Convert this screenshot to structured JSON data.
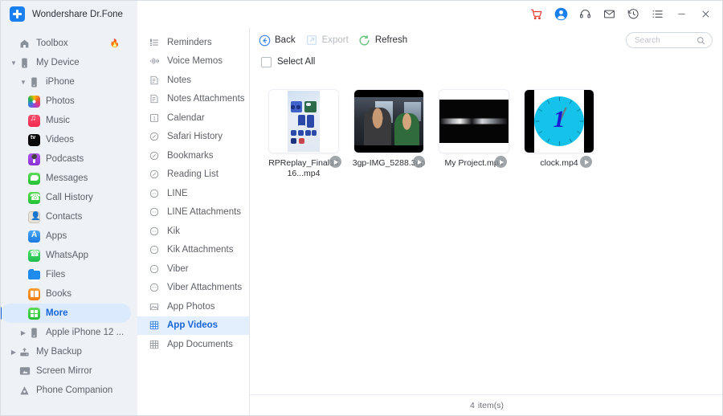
{
  "window": {
    "app_title": "Wondershare Dr.Fone",
    "logo_icon": "drfone-plus-logo",
    "titlebar_icons": [
      {
        "name": "shopping-cart-icon",
        "color": "#e8342a"
      },
      {
        "name": "user-account-icon",
        "color": "#1a7ff0"
      },
      {
        "name": "support-headset-icon",
        "color": "#4a4f57"
      },
      {
        "name": "mail-icon",
        "color": "#4a4f57"
      },
      {
        "name": "history-clock-icon",
        "color": "#4a4f57"
      },
      {
        "name": "menu-list-icon",
        "color": "#4a4f57"
      },
      {
        "name": "minimize-icon",
        "color": "#4a4f57"
      },
      {
        "name": "close-icon",
        "color": "#4a4f57"
      }
    ]
  },
  "sidebar": {
    "items": [
      {
        "label": "Toolbox",
        "icon": "home-icon",
        "level": 1,
        "chevron": "",
        "selected": false,
        "badge": "fire-icon"
      },
      {
        "label": "My Device",
        "icon": "device-icon",
        "level": 1,
        "chevron": "v",
        "selected": false
      },
      {
        "label": "iPhone",
        "icon": "iphone-icon",
        "level": 2,
        "chevron": "v",
        "selected": false
      },
      {
        "label": "Photos",
        "icon": "photos-app-icon",
        "level": 3,
        "chevron": "",
        "selected": false
      },
      {
        "label": "Music",
        "icon": "music-app-icon",
        "level": 3,
        "chevron": "",
        "selected": false
      },
      {
        "label": "Videos",
        "icon": "appletv-app-icon",
        "level": 3,
        "chevron": "",
        "selected": false
      },
      {
        "label": "Podcasts",
        "icon": "podcasts-app-icon",
        "level": 3,
        "chevron": "",
        "selected": false
      },
      {
        "label": "Messages",
        "icon": "messages-app-icon",
        "level": 3,
        "chevron": "",
        "selected": false
      },
      {
        "label": "Call History",
        "icon": "phone-app-icon",
        "level": 3,
        "chevron": "",
        "selected": false
      },
      {
        "label": "Contacts",
        "icon": "contacts-app-icon",
        "level": 3,
        "chevron": "",
        "selected": false
      },
      {
        "label": "Apps",
        "icon": "appstore-app-icon",
        "level": 3,
        "chevron": "",
        "selected": false
      },
      {
        "label": "WhatsApp",
        "icon": "whatsapp-app-icon",
        "level": 3,
        "chevron": "",
        "selected": false
      },
      {
        "label": "Files",
        "icon": "files-app-icon",
        "level": 3,
        "chevron": "",
        "selected": false
      },
      {
        "label": "Books",
        "icon": "books-app-icon",
        "level": 3,
        "chevron": "",
        "selected": false
      },
      {
        "label": "More",
        "icon": "more-app-icon",
        "level": 3,
        "chevron": "",
        "selected": true
      },
      {
        "label": "Apple iPhone 12 ...",
        "icon": "iphone-icon",
        "level": 2,
        "chevron": ">",
        "selected": false
      },
      {
        "label": "My Backup",
        "icon": "backup-icon",
        "level": 1,
        "chevron": ">",
        "selected": false
      },
      {
        "label": "Screen Mirror",
        "icon": "screen-mirror-icon",
        "level": 1,
        "chevron": "",
        "selected": false
      },
      {
        "label": "Phone Companion",
        "icon": "phone-companion-icon",
        "level": 1,
        "chevron": "",
        "selected": false
      }
    ]
  },
  "categories": {
    "items": [
      {
        "label": "Reminders",
        "icon": "reminders-icon",
        "selected": false
      },
      {
        "label": "Voice Memos",
        "icon": "waveform-icon",
        "selected": false
      },
      {
        "label": "Notes",
        "icon": "note-icon",
        "selected": false
      },
      {
        "label": "Notes Attachments",
        "icon": "note-icon",
        "selected": false
      },
      {
        "label": "Calendar",
        "icon": "calendar-icon",
        "selected": false
      },
      {
        "label": "Safari History",
        "icon": "safari-compass-icon",
        "selected": false
      },
      {
        "label": "Bookmarks",
        "icon": "safari-compass-icon",
        "selected": false
      },
      {
        "label": "Reading List",
        "icon": "safari-compass-icon",
        "selected": false
      },
      {
        "label": "LINE",
        "icon": "chat-bubble-icon",
        "selected": false
      },
      {
        "label": "LINE Attachments",
        "icon": "chat-bubble-icon",
        "selected": false
      },
      {
        "label": "Kik",
        "icon": "chat-bubble-icon",
        "selected": false
      },
      {
        "label": "Kik Attachments",
        "icon": "chat-bubble-icon",
        "selected": false
      },
      {
        "label": "Viber",
        "icon": "chat-bubble-icon",
        "selected": false
      },
      {
        "label": "Viber Attachments",
        "icon": "chat-bubble-icon",
        "selected": false
      },
      {
        "label": "App Photos",
        "icon": "photo-frame-icon",
        "selected": false
      },
      {
        "label": "App Videos",
        "icon": "film-grid-icon",
        "selected": true
      },
      {
        "label": "App Documents",
        "icon": "film-grid-icon",
        "selected": false
      }
    ]
  },
  "toolbar": {
    "back_label": "Back",
    "back_icon": "back-arrow-icon",
    "export_label": "Export",
    "export_icon": "export-icon",
    "export_disabled": true,
    "refresh_label": "Refresh",
    "refresh_icon": "refresh-icon",
    "select_all_label": "Select All",
    "select_all_checked": false
  },
  "search": {
    "placeholder": "Search",
    "value": "",
    "icon": "search-icon"
  },
  "files": [
    {
      "name": "RPReplay_Final1616...mp4",
      "thumb": "ios-control-center-recording",
      "play_icon": "play-icon"
    },
    {
      "name": "3gp-IMG_5288.3gp",
      "thumb": "car-scene-video",
      "play_icon": "play-icon"
    },
    {
      "name": "My Project.mp4",
      "thumb": "dark-streak-video",
      "play_icon": "play-icon"
    },
    {
      "name": "clock.mp4",
      "thumb": "cyan-clock-video",
      "play_icon": "play-icon"
    }
  ],
  "status": {
    "count": "4",
    "label": "item(s)"
  },
  "colors": {
    "accent": "#1565d8",
    "sidebar_bg": "#eef2f7",
    "selected_bg": "#e3effd",
    "cart_red": "#e8342a"
  }
}
